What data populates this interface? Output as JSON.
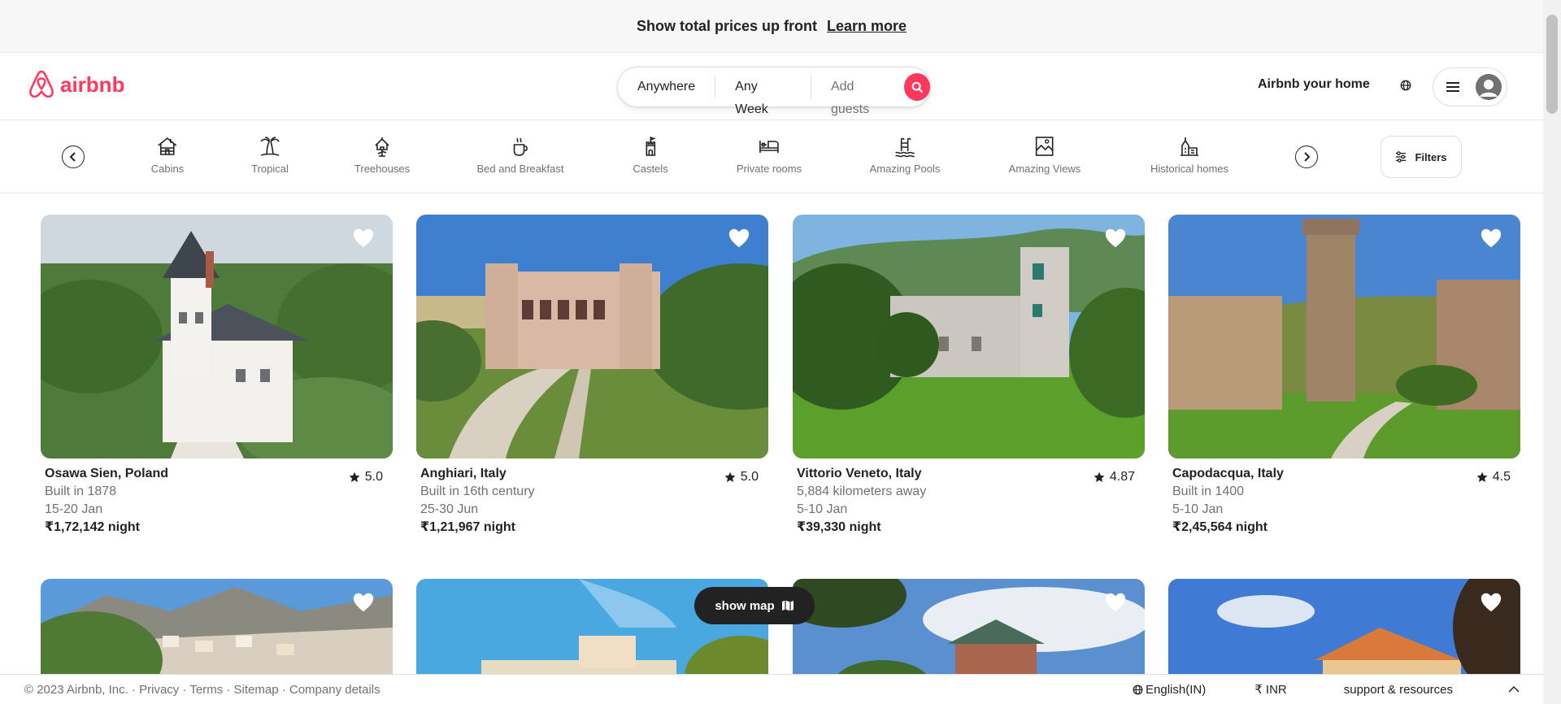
{
  "banner": {
    "message": "Show total prices up front",
    "link": "Learn more"
  },
  "header": {
    "brand": "airbnb",
    "search": {
      "where": "Anywhere",
      "when": "Any Week",
      "guests": "Add guests"
    },
    "host_link": "Airbnb your home"
  },
  "categories": [
    "Cabins",
    "Tropical",
    "Treehouses",
    "Bed and Breakfast",
    "Castels",
    "Private rooms",
    "Amazing Pools",
    "Amazing Views",
    "Historical homes"
  ],
  "filters_label": "Filters",
  "listings": [
    {
      "title": "Osawa Sien, Poland",
      "subtitle": "Built in 1878",
      "dates": "15-20 Jan",
      "price": "₹1,72,142 night",
      "rating": "5.0"
    },
    {
      "title": "Anghiari, Italy",
      "subtitle": "Built in 16th century",
      "dates": "25-30 Jun",
      "price": "₹1,21,967 night",
      "rating": "5.0"
    },
    {
      "title": "Vittorio Veneto, Italy",
      "subtitle": "5,884 kilometers away",
      "dates": "5-10 Jan",
      "price": "₹39,330 night",
      "rating": "4.87"
    },
    {
      "title": "Capodacqua, Italy",
      "subtitle": "Built in 1400",
      "dates": "5-10 Jan",
      "price": "₹2,45,564 night",
      "rating": "4.5"
    }
  ],
  "show_map_label": "show map",
  "footer": {
    "copyright": "© 2023 Airbnb, Inc. · Privacy · Terms · Sitemap · Company details",
    "language": "English(IN)",
    "currency": "₹ INR",
    "support": "support & resources"
  },
  "colors": {
    "brand": "#ff385c",
    "text": "#222222",
    "muted": "#717171"
  }
}
